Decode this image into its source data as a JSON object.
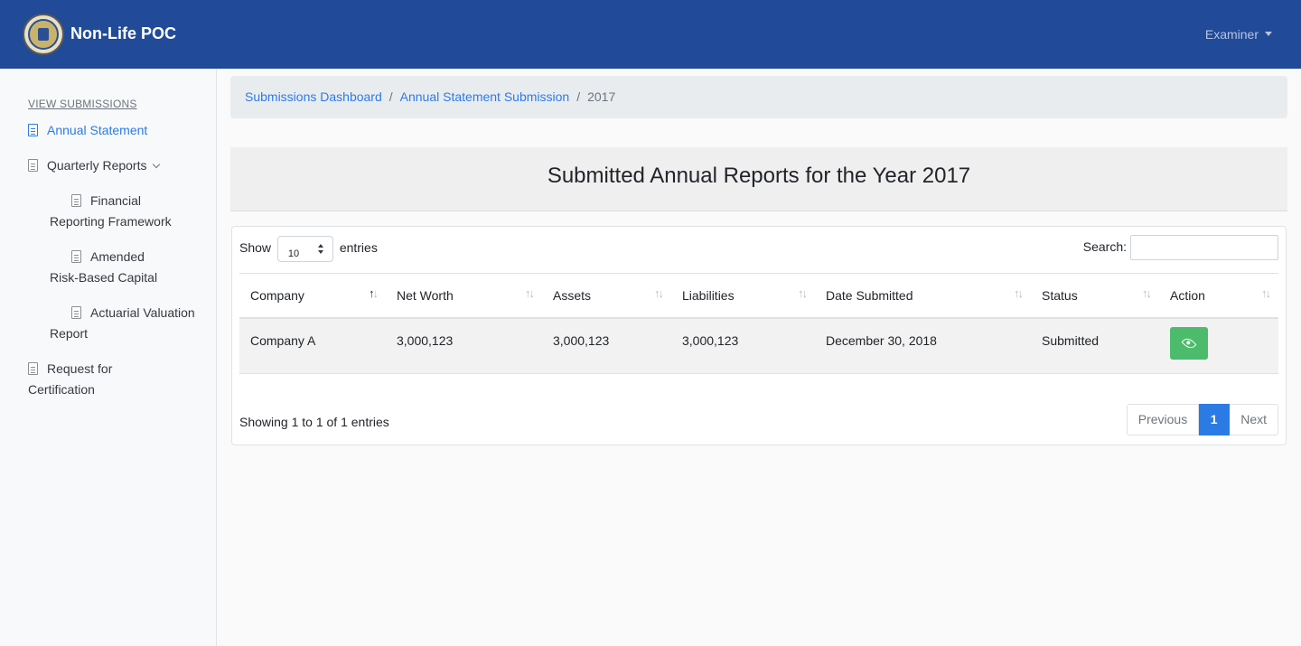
{
  "app": {
    "title": "Non-Life POC",
    "user_label": "Examiner"
  },
  "sidebar": {
    "heading": "VIEW SUBMISSIONS",
    "items": [
      {
        "label": "Annual Statement",
        "active": true
      },
      {
        "label": "Quarterly Reports",
        "expandable": true
      },
      {
        "label": "Financial Reporting Framework"
      },
      {
        "label": "Amended Risk-Based Capital"
      },
      {
        "label": "Actuarial Valuation Report"
      },
      {
        "label": "Request for Certification"
      }
    ]
  },
  "breadcrumb": [
    "Submissions Dashboard",
    "Annual Statement Submission",
    "2017"
  ],
  "page_title": "Submitted Annual Reports for the Year 2017",
  "table": {
    "length_prefix": "Show",
    "length_value": "10",
    "length_suffix": "entries",
    "search_label": "Search:",
    "search_value": "",
    "columns": [
      "Company",
      "Net Worth",
      "Assets",
      "Liabilities",
      "Date Submitted",
      "Status",
      "Action"
    ],
    "rows": [
      [
        "Company A",
        "3,000,123",
        "3,000,123",
        "3,000,123",
        "December 30, 2018",
        "Submitted"
      ]
    ],
    "action_icon": "eye-icon",
    "action_color": "#4cbb6c",
    "info": "Showing 1 to 1 of 1 entries",
    "pagination": {
      "previous": "Previous",
      "current": "1",
      "next": "Next"
    }
  },
  "colors": {
    "navbar": "#214a98",
    "link": "#2c7be5",
    "button": "#4cbb6c"
  }
}
